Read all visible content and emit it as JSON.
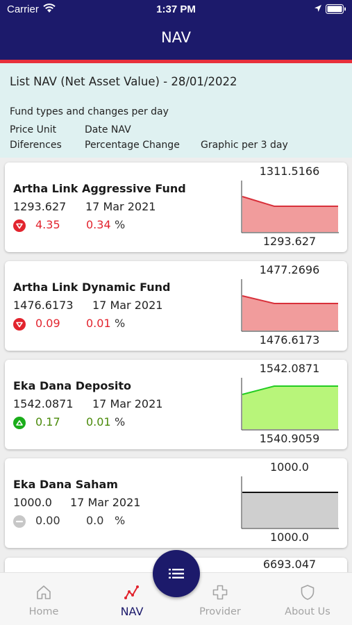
{
  "status_bar": {
    "carrier": "Carrier",
    "time": "1:37 PM"
  },
  "header": {
    "title": "NAV"
  },
  "info": {
    "title": "List NAV (Net Asset Value) - 28/01/2022",
    "subtitle": "Fund types and changes per day",
    "price_unit": "Price Unit",
    "date_nav": "Date NAV",
    "differences": "Diferences",
    "percentage_change": "Percentage Change",
    "graphic": "Graphic per 3 day"
  },
  "funds": [
    {
      "name": "Artha Link Aggressive Fund",
      "price": "1293.627",
      "date": "17 Mar 2021",
      "trend": "down",
      "diff": "4.35",
      "pct": "0.34",
      "pct_sign": "%",
      "chart_max": "1311.5166",
      "chart_min": "1293.627",
      "chart_color": "#f19c9c",
      "line_color": "#d8303a"
    },
    {
      "name": "Artha Link Dynamic Fund",
      "price": "1476.6173",
      "date": "17 Mar 2021",
      "trend": "down",
      "diff": "0.09",
      "pct": "0.01",
      "pct_sign": "%",
      "chart_max": "1477.2696",
      "chart_min": "1476.6173",
      "chart_color": "#f19c9c",
      "line_color": "#d8303a"
    },
    {
      "name": "Eka Dana Deposito",
      "price": "1542.0871",
      "date": "17 Mar 2021",
      "trend": "up",
      "diff": "0.17",
      "pct": "0.01",
      "pct_sign": "%",
      "chart_max": "1542.0871",
      "chart_min": "1540.9059",
      "chart_color": "#b8f57a",
      "line_color": "#22cc22"
    },
    {
      "name": "Eka Dana Saham",
      "price": "1000.0",
      "date": "17 Mar 2021",
      "trend": "flat",
      "diff": "0.00",
      "pct": "0.0",
      "pct_sign": "%",
      "chart_max": "1000.0",
      "chart_min": "1000.0",
      "chart_color": "#cfcfcf",
      "line_color": "#111111"
    }
  ],
  "partial_fund": {
    "chart_max": "6693.047"
  },
  "tabbar": {
    "home": "Home",
    "nav": "NAV",
    "provider": "Provider",
    "about": "About Us"
  },
  "colors": {
    "primary": "#1c1a6b",
    "accent": "#e8303c",
    "panel": "#dff1f1"
  },
  "icons": [
    "wifi-icon",
    "location-icon",
    "battery-icon",
    "home-icon",
    "nav-chart-icon",
    "provider-cross-icon",
    "shield-icon",
    "list-menu-icon"
  ]
}
